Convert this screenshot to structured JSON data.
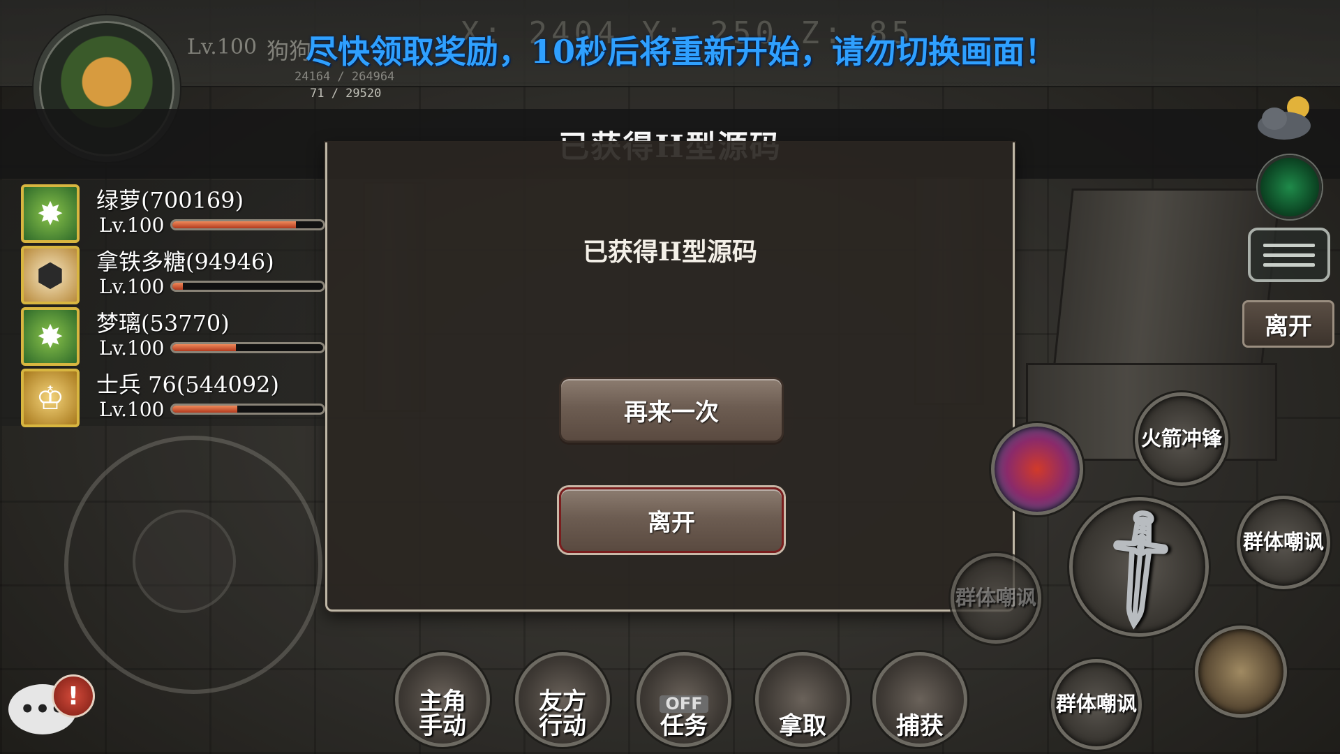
{
  "hud": {
    "player_level": "Lv.100",
    "player_name": "狗狗",
    "ghost_coords": "X: 2404   Y: 250   Z: 85",
    "hp_text": "24164 / 264964",
    "exp_text": "71 / 29520",
    "notice": "尽快领取奖励，10秒后将重新开始，请勿切换画面！"
  },
  "dialog": {
    "title": "已获得H型源码",
    "message": "已获得H型源码",
    "retry_label": "再来一次",
    "leave_label": "离开"
  },
  "party": [
    {
      "name": "绿萝(700169)",
      "level": "Lv.100",
      "hp": 0.82,
      "icon": "burst-icon"
    },
    {
      "name": "拿铁多糖(94946)",
      "level": "Lv.100",
      "hp": 0.07,
      "icon": "shield-icon"
    },
    {
      "name": "梦璃(53770)",
      "level": "Lv.100",
      "hp": 0.42,
      "icon": "burst-icon"
    },
    {
      "name": "士兵 76(544092)",
      "level": "Lv.100",
      "hp": 0.43,
      "icon": "crown-icon"
    }
  ],
  "side": {
    "leave_label": "离开"
  },
  "skills": {
    "rocket_charge": "火箭冲锋",
    "group_taunt_right": "群体嘲讽",
    "group_taunt_left": "群体嘲讽",
    "group_taunt_bottom": "群体嘲讽"
  },
  "commands": {
    "manual": "主角手动",
    "friendly": "友方行动",
    "off_badge": "OFF",
    "quest": "任务",
    "grab": "拿取",
    "capture": "捕获"
  },
  "chat": {
    "bubble": "•••",
    "alert": "!"
  },
  "colors": {
    "notice": "#2fa0ff",
    "hp_bar": "#d04a28",
    "dialog_border": "#bfb7a6"
  }
}
